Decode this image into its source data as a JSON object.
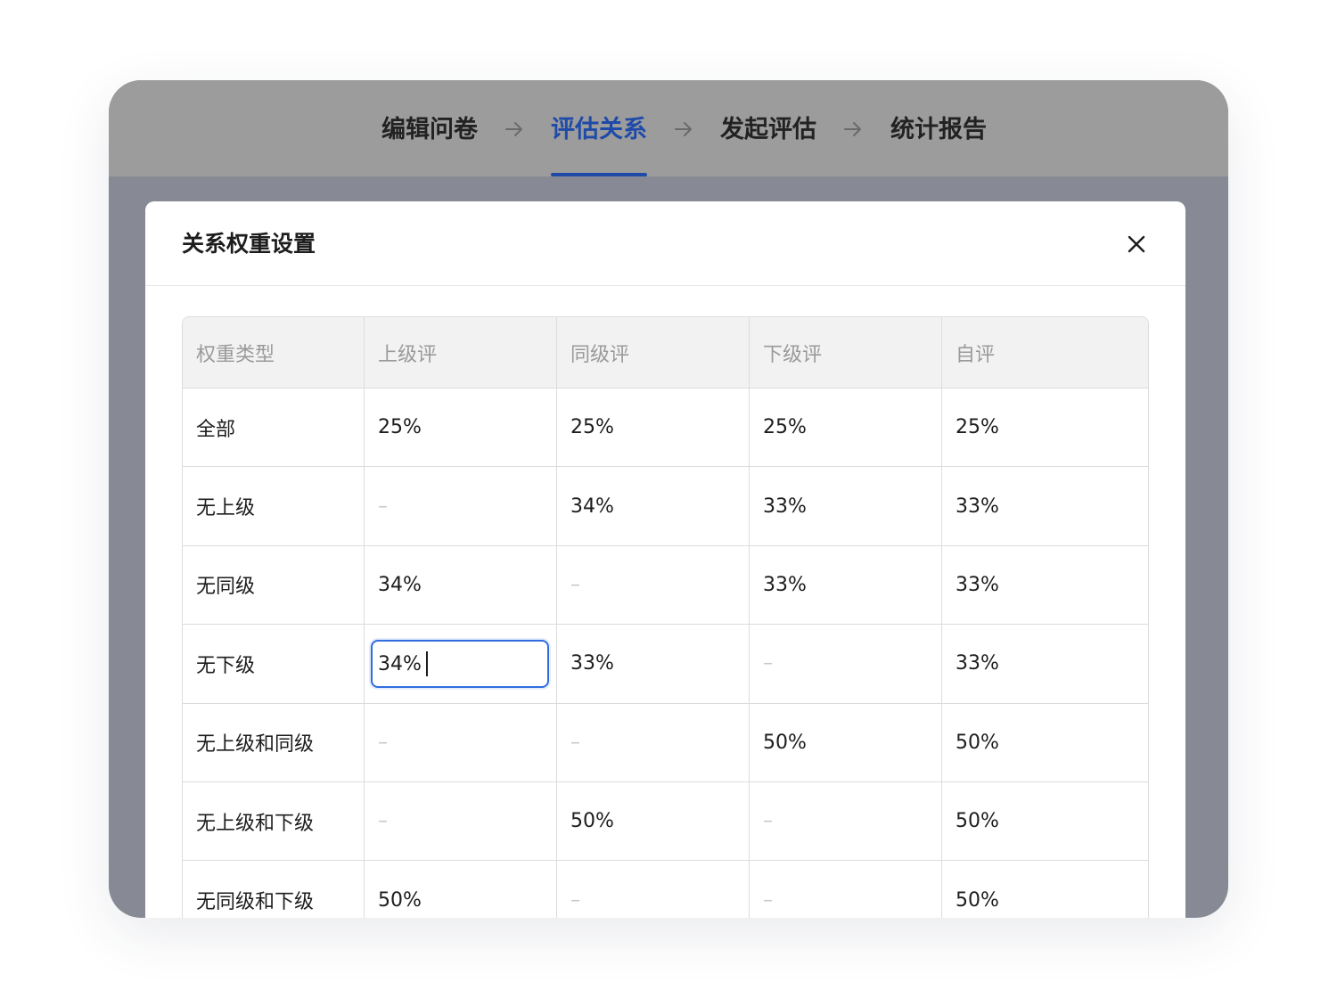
{
  "steps": [
    {
      "label": "编辑问卷",
      "active": false
    },
    {
      "label": "评估关系",
      "active": true
    },
    {
      "label": "发起评估",
      "active": false
    },
    {
      "label": "统计报告",
      "active": false
    }
  ],
  "dialog": {
    "title": "关系权重设置",
    "close_icon": "close-icon"
  },
  "table": {
    "headers": [
      "权重类型",
      "上级评",
      "同级评",
      "下级评",
      "自评"
    ],
    "rows": [
      [
        "全部",
        "25%",
        "25%",
        "25%",
        "25%"
      ],
      [
        "无上级",
        "–",
        "34%",
        "33%",
        "33%"
      ],
      [
        "无同级",
        "34%",
        "–",
        "33%",
        "33%"
      ],
      [
        "无下级",
        "34%",
        "33%",
        "–",
        "33%"
      ],
      [
        "无上级和同级",
        "–",
        "–",
        "50%",
        "50%"
      ],
      [
        "无上级和下级",
        "–",
        "50%",
        "–",
        "50%"
      ],
      [
        "无同级和下级",
        "50%",
        "–",
        "–",
        "50%"
      ]
    ],
    "editing_cell": {
      "row": 3,
      "col": 1,
      "value": "34%"
    }
  },
  "colors": {
    "accent": "#1f4aa8",
    "focus_border": "#2f6de0",
    "overlay": "#878a94",
    "stepbar": "#9c9c9c"
  }
}
